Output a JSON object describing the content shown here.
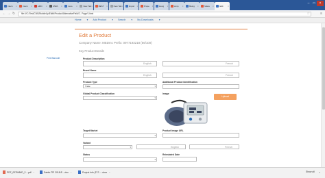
{
  "browser": {
    "tabs": [
      {
        "label": "Intern",
        "fav": "#3f76c4"
      },
      {
        "label": "Intern",
        "fav": "#e25a3c"
      },
      {
        "label": "HRD",
        "fav": "#d63a2f"
      },
      {
        "label": "MWA",
        "fav": "#5a5a5a"
      },
      {
        "label": "Auto",
        "fav": "#3f76c4"
      },
      {
        "label": "New Tab",
        "fav": "#9aa0a6"
      },
      {
        "label": "BEST",
        "fav": "#e25a3c"
      },
      {
        "label": "New Tab",
        "fav": "#9aa0a6"
      },
      {
        "label": "Import",
        "fav": "#3f76c4"
      },
      {
        "label": "Prope",
        "fav": "#e25a3c"
      },
      {
        "label": "Hong",
        "fav": "#3f76c4"
      },
      {
        "label": "simp",
        "fav": "#e25a3c"
      },
      {
        "label": "Being",
        "fav": "#3f76c4"
      },
      {
        "label": "Mana",
        "fav": "#e25a3c"
      },
      {
        "label": "Edit",
        "fav": "#3f76c4"
      }
    ],
    "address": "file:///C:/Test/CMS/MobileUp/EditIt/Product/AlternativeField/2 - Page/1.html"
  },
  "app_nav": [
    "Home",
    "Add Product",
    "Search",
    "My Downloads"
  ],
  "side_link": "Print Barcode",
  "form": {
    "title": "Edit a Product",
    "company": "Company Name: MEDmc Prefix: 0977193218 (56/100)",
    "section": "Key Product Details",
    "product_description_label": "Product Description",
    "brand_name_label": "Brand Name",
    "product_type_label": "Product Type",
    "product_type_value": "Trade",
    "additional_id_label": "Additional Product Identification",
    "gpc_label": "Global Product Classification",
    "image_label": "Image",
    "upload_label": "Upload",
    "target_market_label": "Target Market",
    "product_image_url_label": "Product Image URL",
    "variant_label": "Variant",
    "status_label": "Status",
    "reinstated_label": "Reinstated Date",
    "lang_english": "English",
    "lang_french": "French"
  },
  "downloads": [
    {
      "name": "PDF_0378484D_2....pdf",
      "type": "pdf"
    },
    {
      "name": "Sabtio TPI 2018-E....doc",
      "type": "doc"
    },
    {
      "name": "Project Info (F17-....docx",
      "type": "doc"
    }
  ],
  "downloads_bar": {
    "show_all": "Show all"
  }
}
